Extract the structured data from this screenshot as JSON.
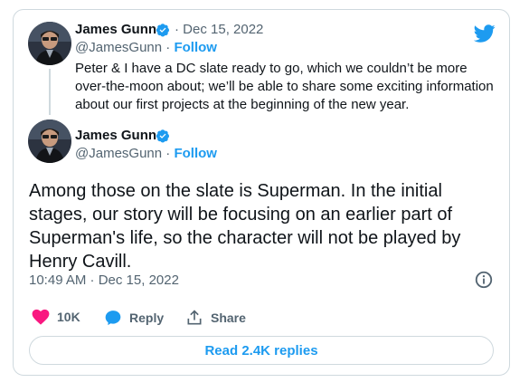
{
  "colors": {
    "accent": "#1d9bf0",
    "like": "#f91880",
    "text": "#0f1419",
    "muted": "#536471",
    "border": "#cfd9de"
  },
  "quoted_tweet": {
    "author_name": "James Gunn",
    "verified_icon": "verified-badge-icon",
    "date": "Dec 15, 2022",
    "handle": "@JamesGunn",
    "follow_label": "Follow",
    "text": "Peter & I have a DC slate ready to go, which we couldn’t be more over-the-moon about; we’ll be able to share some exciting information about our first projects at the beginning of the new year."
  },
  "main_tweet": {
    "author_name": "James Gunn",
    "verified_icon": "verified-badge-icon",
    "handle": "@JamesGunn",
    "follow_label": "Follow",
    "text": "Among those on the slate is Superman. In the initial stages, our story will be focusing on an earlier part of Superman's life, so the character will not be played by Henry Cavill.",
    "timestamp": "10:49 AM · Dec 15, 2022"
  },
  "actions": {
    "like_count": "10K",
    "reply_label": "Reply",
    "share_label": "Share"
  },
  "replies_button": {
    "label": "Read 2.4K replies"
  },
  "brand_icon": "twitter-bird-icon"
}
